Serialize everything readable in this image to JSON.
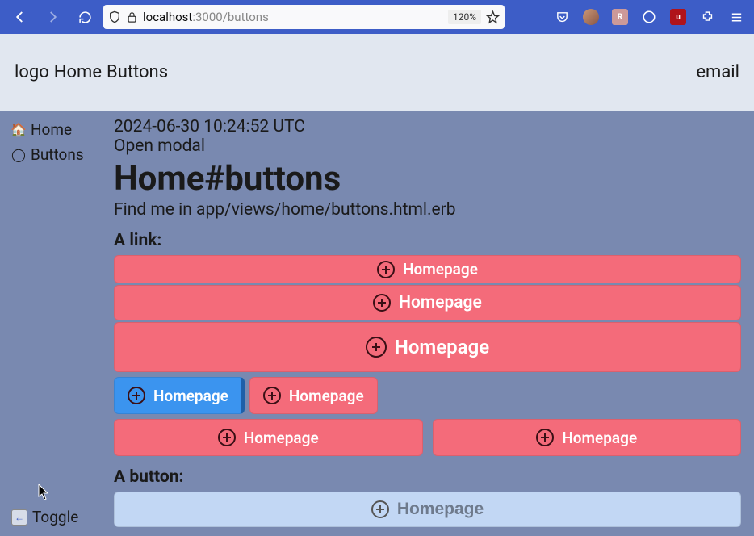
{
  "browser": {
    "url_host": "localhost",
    "url_port": ":3000",
    "url_path": "/buttons",
    "zoom": "120%"
  },
  "header": {
    "logo": "logo",
    "home": "Home",
    "buttons": "Buttons",
    "email": "email"
  },
  "sidebar": {
    "items": [
      {
        "icon": "🏠",
        "label": "Home"
      },
      {
        "icon": "◯",
        "label": "Buttons"
      }
    ],
    "toggle": "Toggle"
  },
  "main": {
    "timestamp": "2024-06-30 10:24:52 UTC",
    "modal_link": "Open modal",
    "heading": "Home#buttons",
    "subheading": "Find me in app/views/home/buttons.html.erb",
    "link_section": "A link:",
    "button_section": "A button:",
    "btn_label": "Homepage"
  }
}
